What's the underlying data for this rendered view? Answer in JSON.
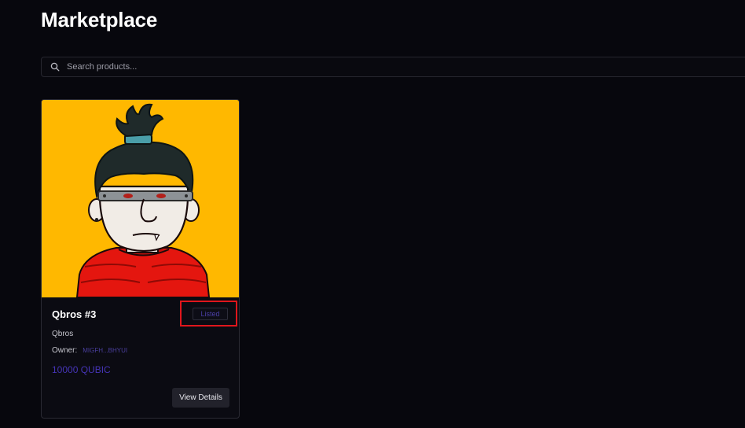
{
  "header": {
    "title": "Marketplace"
  },
  "search": {
    "placeholder": "Search products...",
    "value": "",
    "icon": "search-icon"
  },
  "products": [
    {
      "name": "Qbros #3",
      "status": "Listed",
      "collection": "Qbros",
      "owner_label": "Owner:",
      "owner_address": "MIGFH...BHYUI",
      "price": "10000 QUBIC",
      "button_label": "View Details"
    }
  ],
  "colors": {
    "background": "#07070d",
    "card_image_bg": "#ffb800",
    "accent": "#4534b6",
    "highlight": "#e0161c"
  }
}
